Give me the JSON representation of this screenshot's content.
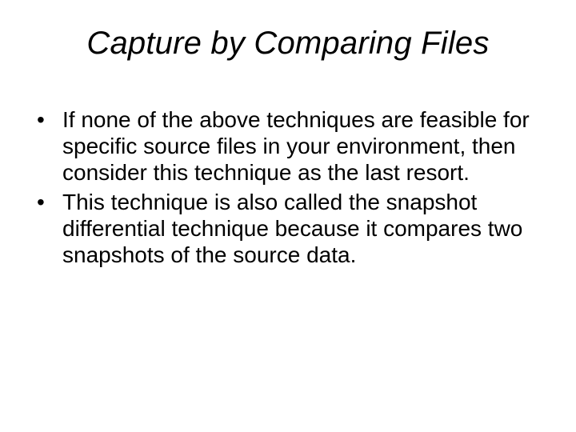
{
  "title": "Capture by Comparing Files",
  "bullets": [
    "If none of the above techniques are feasible for specific source files in your environment, then consider this technique as the last resort.",
    "This technique is also called the snapshot differential technique because it compares two snapshots of the source data."
  ]
}
